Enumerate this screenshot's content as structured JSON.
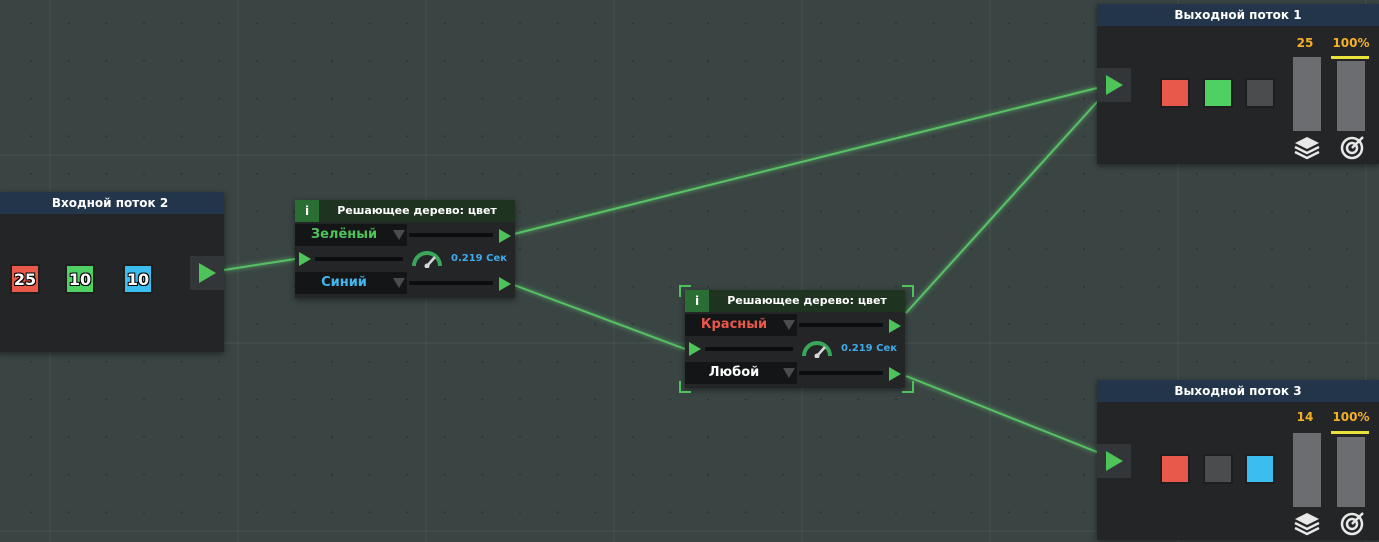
{
  "input_node": {
    "title": "Входной поток 2",
    "tokens": [
      {
        "value": "25",
        "color": "#e8584b"
      },
      {
        "value": "10",
        "color": "#4fd063"
      },
      {
        "value": "10",
        "color": "#3bbdf0"
      }
    ]
  },
  "decision_nodes": [
    {
      "info_label": "i",
      "title": "Решающее дерево: цвет",
      "branch_1": {
        "label": "Зелёный",
        "color": "#4ec35a"
      },
      "branch_2": {
        "label": "Синий",
        "color": "#41b7ee"
      },
      "timer": "0.219 Сек"
    },
    {
      "info_label": "i",
      "title": "Решающее дерево: цвет",
      "branch_1": {
        "label": "Красный",
        "color": "#e8584b"
      },
      "branch_2": {
        "label": "Любой",
        "color": "#ffffff"
      },
      "timer": "0.219 Сек"
    }
  ],
  "output_nodes": [
    {
      "title": "Выходной поток 1",
      "count": "25",
      "percent": "100%",
      "fill_percent": 100,
      "slots": [
        "#e8584b",
        "#4fd063",
        "#4a4c4e"
      ],
      "icons": [
        "layers-icon",
        "target-icon"
      ]
    },
    {
      "title": "Выходной поток 3",
      "count": "14",
      "percent": "100%",
      "fill_percent": 100,
      "slots": [
        "#e8584b",
        "#4a4c4e",
        "#3bbdf0"
      ],
      "icons": [
        "layers-icon",
        "target-icon"
      ]
    }
  ],
  "colors": {
    "background": "#3a4443",
    "wire": "#59c166",
    "accent_green": "#4ec35a"
  }
}
